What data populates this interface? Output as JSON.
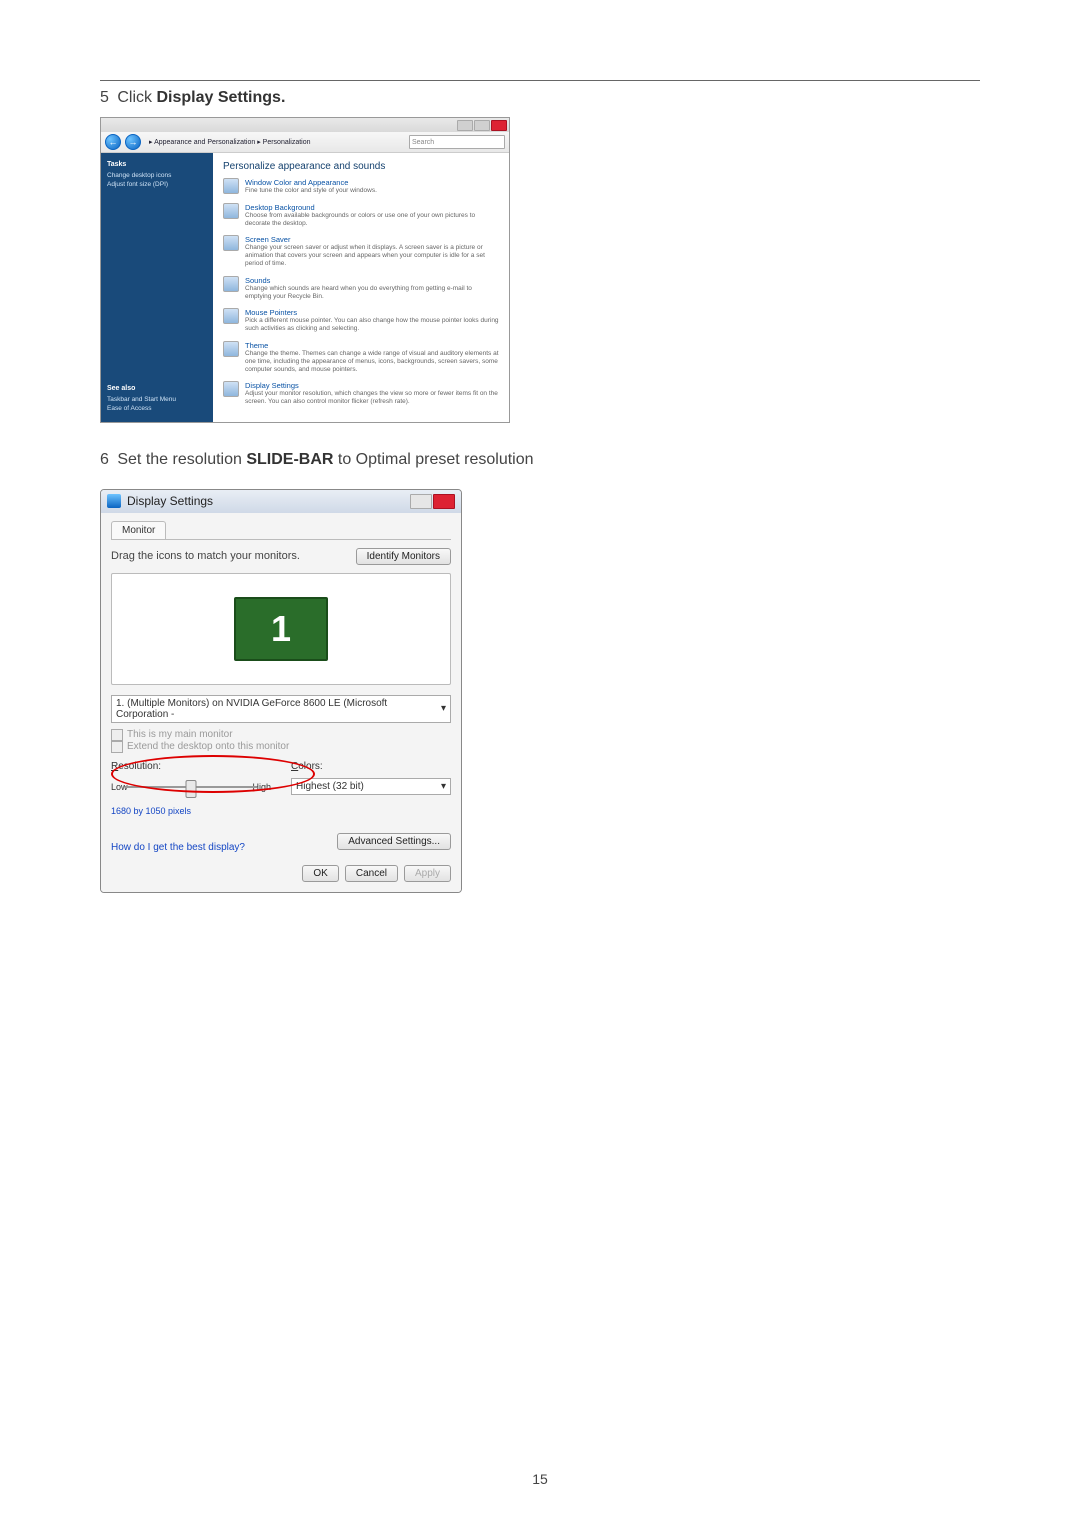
{
  "step5": {
    "num": "5",
    "prefix": "Click ",
    "bold": "Display Settings.",
    "suffix": ""
  },
  "step6": {
    "num": "6",
    "prefix": "Set the resolution ",
    "bold": "SLIDE-BAR",
    "suffix": " to  Optimal preset resolution"
  },
  "page_number": "15",
  "vista": {
    "breadcrumb": "▸ Appearance and Personalization ▸ Personalization",
    "search_placeholder": "Search",
    "side_title": "Tasks",
    "side_links": [
      "Change desktop icons",
      "Adjust font size (DPI)"
    ],
    "side_seealso": "See also",
    "side_bottom": [
      "Taskbar and Start Menu",
      "Ease of Access"
    ],
    "heading": "Personalize appearance and sounds",
    "items": [
      {
        "title": "Window Color and Appearance",
        "desc": "Fine tune the color and style of your windows."
      },
      {
        "title": "Desktop Background",
        "desc": "Choose from available backgrounds or colors or use one of your own pictures to decorate the desktop."
      },
      {
        "title": "Screen Saver",
        "desc": "Change your screen saver or adjust when it displays. A screen saver is a picture or animation that covers your screen and appears when your computer is idle for a set period of time."
      },
      {
        "title": "Sounds",
        "desc": "Change which sounds are heard when you do everything from getting e-mail to emptying your Recycle Bin."
      },
      {
        "title": "Mouse Pointers",
        "desc": "Pick a different mouse pointer. You can also change how the mouse pointer looks during such activities as clicking and selecting."
      },
      {
        "title": "Theme",
        "desc": "Change the theme. Themes can change a wide range of visual and auditory elements at one time, including the appearance of menus, icons, backgrounds, screen savers, some computer sounds, and mouse pointers."
      },
      {
        "title": "Display Settings",
        "desc": "Adjust your monitor resolution, which changes the view so more or fewer items fit on the screen. You can also control monitor flicker (refresh rate)."
      }
    ]
  },
  "dlg": {
    "title": "Display Settings",
    "tab": "Monitor",
    "drag_label": "Drag the icons to match your monitors.",
    "identify_btn": "Identify Monitors",
    "monitor_number": "1",
    "dropdown": "1. (Multiple Monitors) on NVIDIA GeForce 8600 LE (Microsoft Corporation - ",
    "chk1": "This is my main monitor",
    "chk2": "Extend the desktop onto this monitor",
    "res_label_u": "R",
    "res_label_rest": "esolution:",
    "res_low": "Low",
    "res_high": "High",
    "res_caption": "1680 by 1050 pixels",
    "col_label_u": "C",
    "col_label_rest": "olors:",
    "col_value": "Highest (32 bit)",
    "help": "How do I get the best display?",
    "adv_btn": "Advanced Settings...",
    "ok": "OK",
    "cancel": "Cancel",
    "apply": "Apply"
  }
}
